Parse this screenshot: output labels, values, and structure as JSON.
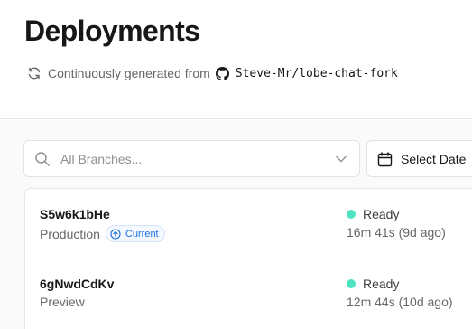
{
  "page": {
    "title": "Deployments",
    "subtitle_prefix": "Continuously generated from",
    "repo": "Steve-Mr/lobe-chat-fork",
    "icons": {
      "sync": "refresh-icon",
      "repo": "github-icon"
    }
  },
  "filters": {
    "branch_placeholder": "All Branches...",
    "date_label": "Select Date",
    "icons": {
      "search": "search-icon",
      "dropdown": "chevron-down-icon",
      "date": "calendar-icon"
    }
  },
  "deployments": [
    {
      "id": "S5w6k1bHe",
      "environment": "Production",
      "badge": "Current",
      "status": "Ready",
      "duration": "16m 41s (9d ago)"
    },
    {
      "id": "6gNwdCdKv",
      "environment": "Preview",
      "badge": "",
      "status": "Ready",
      "duration": "12m 44s (10d ago)"
    }
  ],
  "colors": {
    "ready": "#50e3c2",
    "badge": "#1a6fdc"
  }
}
